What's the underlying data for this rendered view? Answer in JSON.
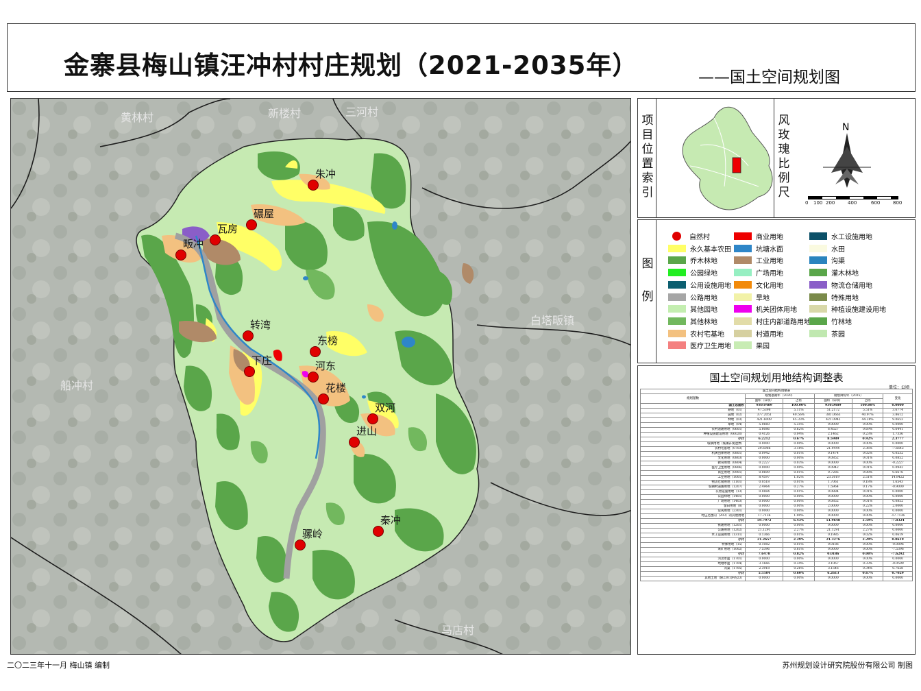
{
  "title": "金寨县梅山镇汪冲村村庄规划（2021-2035年）",
  "subtitle": "——国土空间规划图",
  "map": {
    "neighbors": [
      "黄林村",
      "新楼村",
      "三河村",
      "白塔畈镇",
      "船冲村",
      "马店村"
    ],
    "villages": [
      "朱冲",
      "碾屋",
      "瓦房",
      "畈冲",
      "转湾",
      "东榜",
      "下庄",
      "河东",
      "花楼",
      "双河",
      "进山",
      "秦冲",
      "骡岭"
    ]
  },
  "location_panel": {
    "label": "项目位置索引",
    "rose_label": "风玫瑰比例尺",
    "north": "N",
    "scale": [
      "0",
      "100",
      "200",
      "400",
      "600",
      "800"
    ]
  },
  "legend": {
    "label": "图例",
    "items": [
      {
        "label": "自然村",
        "color": "#e00000",
        "kind": "dot"
      },
      {
        "label": "永久基本农田",
        "color": "#ffff66"
      },
      {
        "label": "乔木林地",
        "color": "#5aa64a"
      },
      {
        "label": "公园绿地",
        "color": "#22ee22"
      },
      {
        "label": "公用设施用地",
        "color": "#0c5f70"
      },
      {
        "label": "公路用地",
        "color": "#a6a6a6"
      },
      {
        "label": "其他园地",
        "color": "#c4eeb0"
      },
      {
        "label": "其他林地",
        "color": "#72b85e"
      },
      {
        "label": "农村宅基地",
        "color": "#f3c180"
      },
      {
        "label": "医疗卫生用地",
        "color": "#f48080"
      },
      {
        "label": "商业用地",
        "color": "#ee0000"
      },
      {
        "label": "坑塘水面",
        "color": "#2e86c8"
      },
      {
        "label": "工业用地",
        "color": "#b08a68"
      },
      {
        "label": "广场用地",
        "color": "#96efc2"
      },
      {
        "label": "文化用地",
        "color": "#f28a0a"
      },
      {
        "label": "旱地",
        "color": "#f2f2a8"
      },
      {
        "label": "机关团体用地",
        "color": "#ee00ee"
      },
      {
        "label": "村庄内部道路用地",
        "color": "#e2dca8"
      },
      {
        "label": "村道用地",
        "color": "#d6d0a0"
      },
      {
        "label": "果园",
        "color": "#c8ecb4"
      },
      {
        "label": "水工设施用地",
        "color": "#0c5068"
      },
      {
        "label": "水田",
        "color": "#fafae0"
      },
      {
        "label": "沟渠",
        "color": "#2a84be"
      },
      {
        "label": "灌木林地",
        "color": "#5aa64a"
      },
      {
        "label": "物流仓储用地",
        "color": "#8a5ec8"
      },
      {
        "label": "特殊用地",
        "color": "#7a8a4a"
      },
      {
        "label": "种植设施建设用地",
        "color": "#d8d8a8"
      },
      {
        "label": "竹林地",
        "color": "#5aa64a"
      },
      {
        "label": "茶园",
        "color": "#c0e8b0"
      }
    ]
  },
  "table": {
    "title": "国土空间规划用地结构调整表",
    "unit": "单位：公顷",
    "unit2": "单位：公顷、%",
    "inner_title": "国土空间结构调整表",
    "headers": [
      "规划基数",
      "规划基期年（2020）",
      "规划目标年（2035）",
      "变化"
    ],
    "subheaders": [
      "面积（公顷）",
      "占比",
      "面积（公顷）",
      "占比"
    ],
    "rows": [
      [
        "国土总面积",
        "930.0489",
        "100.00%",
        "930.0489",
        "100.00%",
        "0.0000"
      ],
      [
        "耕地（01）",
        "47.5398",
        "5.11%",
        "51.2172",
        "5.51%",
        "3.6774"
      ],
      [
        "园地（02）",
        "377.2051",
        "40.56%",
        "381.0663",
        "40.97%",
        "3.8612"
      ],
      [
        "林地（03）",
        "421.6009",
        "45.33%",
        "421.0942",
        "44.28%",
        "9.0653"
      ],
      [
        "草地（04）",
        "5.0660",
        "5.35%",
        "0.0000",
        "0.00%",
        "0.0000"
      ],
      [
        "农村道路用地（0601）",
        "5.8086",
        "0.62%",
        "6.4527",
        "0.69%",
        "0.6441"
      ],
      [
        "种植设施建设用地（06020）",
        "0.4126",
        "0.04%",
        "2.1462",
        "0.23%",
        "1.7336"
      ],
      [
        "小计",
        "6.2212",
        "0.67%",
        "8.5989",
        "0.92%",
        "2.3777"
      ],
      [
        "城镇用地（城镇开发边界）",
        "0.0000",
        "0.00%",
        "0.0000",
        "0.00%",
        "0.0000"
      ],
      [
        "农村宅基地（0703）",
        "29.6086",
        "3.18%",
        "21.9444",
        "2.36%",
        "-7.6642"
      ],
      [
        "机关团体用地（0801）",
        "0.0942",
        "0.01%",
        "0.1474",
        "0.02%",
        "0.0532"
      ],
      [
        "文化用地（0803）",
        "0.0000",
        "0.00%",
        "0.0852",
        "0.01%",
        "0.0852"
      ],
      [
        "教育用地（0804）",
        "0.2227",
        "0.03%",
        "0.0000",
        "0.00%",
        "-0.2227"
      ],
      [
        "医疗卫生用地（0806）",
        "0.0000",
        "0.00%",
        "0.0942",
        "0.01%",
        "0.0942"
      ],
      [
        "商业用地（0901）",
        "0.0609",
        "0.01%",
        "0.7285",
        "0.08%",
        "0.6676"
      ],
      [
        "工业用地（1001）",
        "8.4597",
        "1.02%",
        "23.3019",
        "2.51%",
        "14.8422"
      ],
      [
        "物流仓储用地（1101）",
        "0.0518",
        "0.01%",
        "1.7061",
        "0.18%",
        "1.6543"
      ],
      [
        "城镇村道路用地（1207）",
        "2.4964",
        "0.27%",
        "1.5964",
        "0.17%",
        "-0.9000"
      ],
      [
        "公用设施用地（13）",
        "0.0884",
        "0.01%",
        "0.0884",
        "0.01%",
        "0.0000"
      ],
      [
        "公园绿地（1401）",
        "0.0000",
        "0.00%",
        "0.0000",
        "0.00%",
        "0.0000"
      ],
      [
        "广场用地（1403）",
        "0.0000",
        "0.00%",
        "0.0852",
        "0.01%",
        "0.0852"
      ],
      [
        "留白用地（8）",
        "0.0000",
        "0.00%",
        "2.0000",
        "0.22%",
        "2.0000"
      ],
      [
        "空闲用地（2301）",
        "0.0000",
        "0.00%",
        "0.0000",
        "0.00%",
        "0.0000"
      ],
      [
        "村庄范围内（203）的其他用地",
        "17.7136",
        "1.90%",
        "0.0000",
        "0.00%",
        "-17.7136"
      ],
      [
        "小计",
        "59.7972",
        "6.43%",
        "51.9648",
        "5.59%",
        "-7.8324"
      ],
      [
        "铁路用地（1201）",
        "0.0000",
        "0.00%",
        "0.0000",
        "0.00%",
        "0.0000"
      ],
      [
        "公路用地（1202）",
        "21.1291",
        "2.27%",
        "21.1291",
        "2.27%",
        "0.0000"
      ],
      [
        "水工设施用地（1311）",
        "0.1366",
        "0.01%",
        "0.1985",
        "0.02%",
        "0.0619"
      ],
      [
        "小计",
        "21.2657",
        "2.29%",
        "21.3276",
        "2.29%",
        "0.0619"
      ],
      [
        "特殊用地（15）",
        "0.1082",
        "0.01%",
        "0.0186",
        "0.00%",
        "-0.0896"
      ],
      [
        "采矿用地（1002）",
        "7.5396",
        "0.81%",
        "0.0000",
        "0.00%",
        "-7.5396"
      ],
      [
        "小计",
        "7.6478",
        "0.82%",
        "0.0186",
        "0.00%",
        "-7.6292"
      ],
      [
        "河流水面（1701）",
        "0.0000",
        "0.00%",
        "0.0000",
        "0.00%",
        "0.0000"
      ],
      [
        "坑塘水面（1704）",
        "3.1666",
        "0.34%",
        "3.1067",
        "0.33%",
        "-0.0599"
      ],
      [
        "沟渠（1705）",
        "2.3918",
        "0.26%",
        "3.1546",
        "0.34%",
        "0.7628"
      ],
      [
        "小计",
        "5.5584",
        "0.60%",
        "6.2613",
        "0.67%",
        "0.7029"
      ],
      [
        "其他土地（除2301外的23）",
        "0.0000",
        "0.00%",
        "0.0000",
        "0.00%",
        "0.0000"
      ]
    ]
  },
  "footer": {
    "left": "二〇二三年十一月   梅山镇   编制",
    "right": "苏州规划设计研究院股份有限公司  制图"
  }
}
